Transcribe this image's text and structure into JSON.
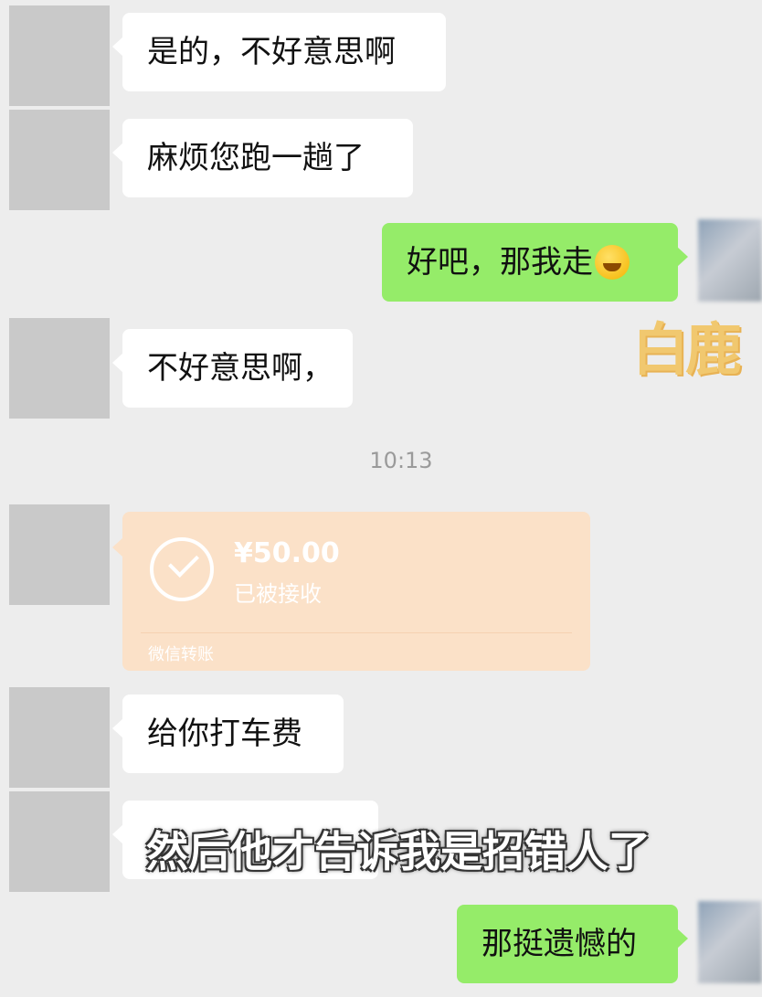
{
  "messages": [
    {
      "side": "left",
      "text": "是的，不好意思啊"
    },
    {
      "side": "left",
      "text": "麻烦您跑一趟了"
    },
    {
      "side": "right",
      "text": "好吧，那我走",
      "emoji": "rolling-laughing-emoji"
    },
    {
      "side": "left",
      "text": "不好意思啊，"
    },
    {
      "side": "left",
      "text": "给你打车费"
    },
    {
      "side": "left",
      "text": "",
      "hidden_by_subtitle": true
    },
    {
      "side": "right",
      "text": "那挺遗憾的"
    }
  ],
  "timestamp": "10:13",
  "transfer": {
    "amount": "¥50.00",
    "status": "已被接收",
    "footer": "微信转账",
    "icon": "check-circle-icon"
  },
  "watermark": "白鹿",
  "subtitle": "然后他才告诉我是招错人了",
  "colors": {
    "background": "#ededed",
    "left_bubble": "#ffffff",
    "right_bubble": "#95ec69",
    "transfer_card": "#fbe1c8"
  }
}
